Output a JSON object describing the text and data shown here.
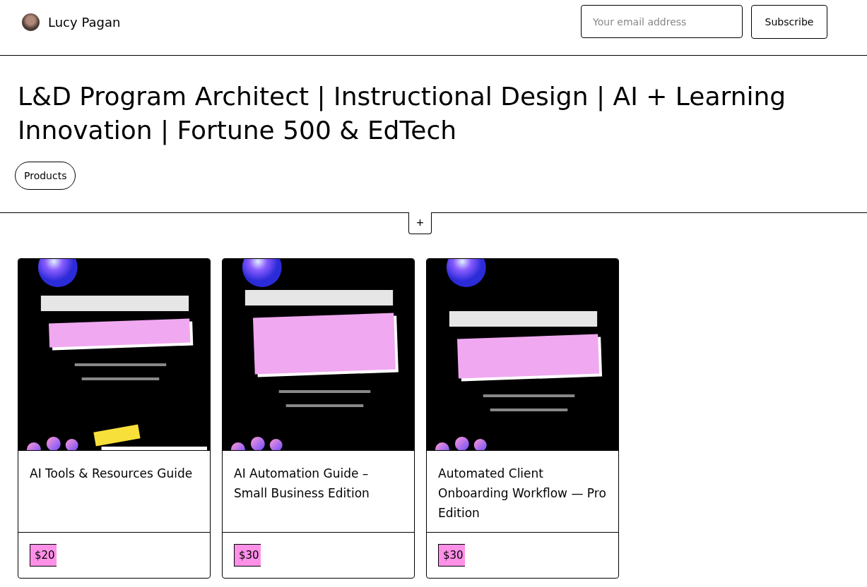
{
  "header": {
    "name": "Lucy Pagan",
    "email": {
      "placeholder": "Your email address"
    },
    "subscribe": "Subscribe"
  },
  "title": "L&D Program Architect | Instructional Design | AI + Learning Innovation | Fortune 500 & EdTech",
  "nav": [
    {
      "label": "Products"
    }
  ],
  "add_button": "+",
  "products": [
    {
      "title": "AI Tools & Resources Guide",
      "price": "$20"
    },
    {
      "title": "AI Automation Guide – Small Business Edition",
      "price": "$30"
    },
    {
      "title": "Automated Client Onboarding Workflow — Pro Edition",
      "price": "$30"
    }
  ]
}
